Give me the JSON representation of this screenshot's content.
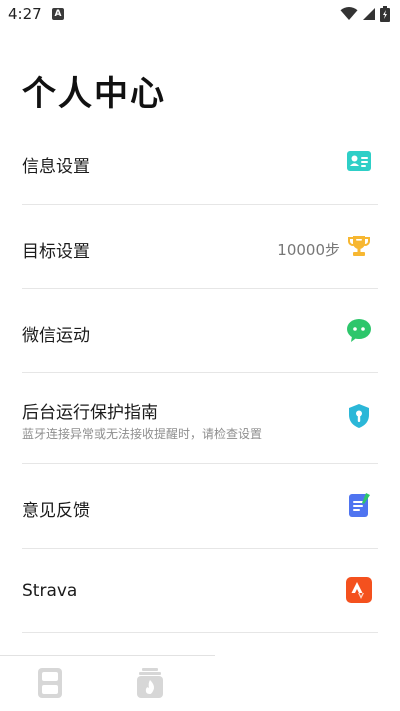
{
  "status_bar": {
    "time": "4:27",
    "notification_badge": "A"
  },
  "page": {
    "title": "个人中心"
  },
  "menu": [
    {
      "label": "信息设置",
      "icon": "id-card-icon",
      "color": "#2ecfc7"
    },
    {
      "label": "目标设置",
      "value": "10000步",
      "icon": "trophy-icon",
      "color": "#f7b731"
    },
    {
      "label": "微信运动",
      "icon": "wechat-icon",
      "color": "#2dc66b"
    },
    {
      "label": "后台运行保护指南",
      "sublabel": "蓝牙连接异常或无法接收提醒时，请检查设置",
      "icon": "shield-icon",
      "color": "#2bb7d8"
    },
    {
      "label": "意见反馈",
      "icon": "feedback-icon",
      "color": "#4f74f0"
    },
    {
      "label": "Strava",
      "icon": "strava-icon",
      "color": "#f4511e"
    }
  ],
  "bottom_nav": [
    {
      "icon": "device-icon"
    },
    {
      "icon": "calorie-icon"
    }
  ]
}
